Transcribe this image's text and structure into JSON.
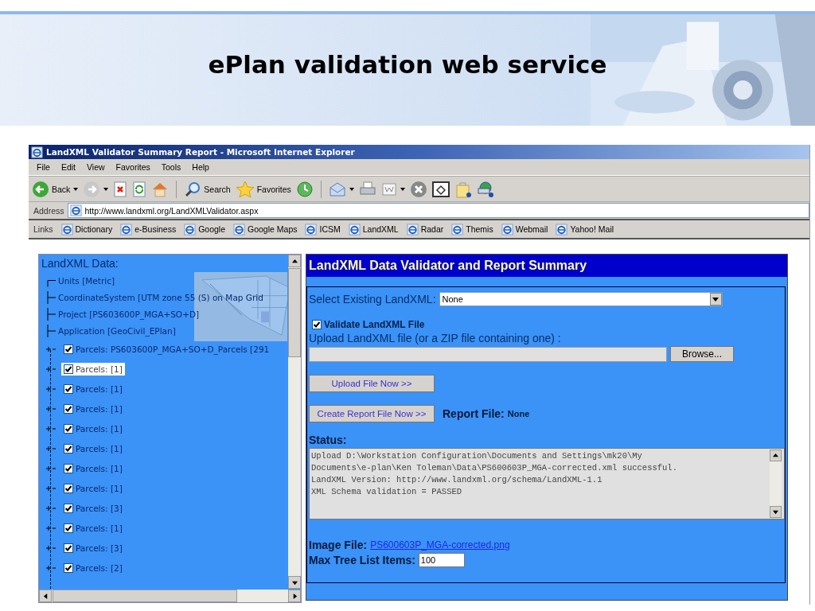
{
  "slide": {
    "title": "ePlan validation web service"
  },
  "window": {
    "title": "LandXML Validator Summary Report - Microsoft Internet Explorer"
  },
  "menu": [
    "File",
    "Edit",
    "View",
    "Favorites",
    "Tools",
    "Help"
  ],
  "toolbar": [
    {
      "kind": "back",
      "label": "Back"
    },
    {
      "kind": "forward"
    },
    {
      "kind": "stop"
    },
    {
      "kind": "refresh"
    },
    {
      "kind": "home"
    },
    {
      "kind": "search",
      "label": "Search"
    },
    {
      "kind": "favorites",
      "label": "Favorites"
    },
    {
      "kind": "history"
    },
    {
      "kind": "mail"
    },
    {
      "kind": "print"
    },
    {
      "kind": "edit"
    },
    {
      "kind": "close"
    },
    {
      "kind": "window"
    },
    {
      "kind": "bag"
    },
    {
      "kind": "messenger"
    }
  ],
  "address": {
    "label": "Address",
    "value": "http://www.landxml.org/LandXMLValidator.aspx"
  },
  "links": {
    "label": "Links",
    "items": [
      "Dictionary",
      "e-Business",
      "Google",
      "Google Maps",
      "ICSM",
      "LandXML",
      "Radar",
      "Themis",
      "Webmail",
      "Yahoo! Mail"
    ]
  },
  "tree": {
    "title": "LandXML Data:",
    "items": [
      {
        "kind": "leaf",
        "label": "Units [Metric]"
      },
      {
        "kind": "leaf",
        "label": "CoordinateSystem [UTM zone 55 (S) on Map Grid"
      },
      {
        "kind": "leaf",
        "label": "Project [PS603600P_MGA+SO+D]"
      },
      {
        "kind": "leaf",
        "label": "Application [GeoCivil_EPlan]"
      },
      {
        "kind": "parcel",
        "label": "Parcels: PS603600P_MGA+SO+D_Parcels [291",
        "checked": true,
        "expanded": false,
        "selected": false
      },
      {
        "kind": "parcel",
        "label": "Parcels: [1]",
        "checked": true,
        "expanded": false,
        "selected": true
      },
      {
        "kind": "parcel",
        "label": "Parcels: [1]",
        "checked": true,
        "expanded": false,
        "selected": false
      },
      {
        "kind": "parcel",
        "label": "Parcels: [1]",
        "checked": true,
        "expanded": false,
        "selected": false
      },
      {
        "kind": "parcel",
        "label": "Parcels: [1]",
        "checked": true,
        "expanded": false,
        "selected": false
      },
      {
        "kind": "parcel",
        "label": "Parcels: [1]",
        "checked": true,
        "expanded": false,
        "selected": false
      },
      {
        "kind": "parcel",
        "label": "Parcels: [1]",
        "checked": true,
        "expanded": false,
        "selected": false
      },
      {
        "kind": "parcel",
        "label": "Parcels: [1]",
        "checked": true,
        "expanded": false,
        "selected": false
      },
      {
        "kind": "parcel",
        "label": "Parcels: [3]",
        "checked": true,
        "expanded": false,
        "selected": false
      },
      {
        "kind": "parcel",
        "label": "Parcels: [1]",
        "checked": true,
        "expanded": false,
        "selected": false
      },
      {
        "kind": "parcel",
        "label": "Parcels: [3]",
        "checked": true,
        "expanded": false,
        "selected": false
      },
      {
        "kind": "parcel",
        "label": "Parcels: [2]",
        "checked": true,
        "expanded": false,
        "selected": false
      }
    ]
  },
  "main": {
    "heading": "LandXML Data Validator and Report Summary",
    "select": {
      "label": "Select Existing LandXML:",
      "value": "None"
    },
    "validate": {
      "label": "Validate LandXML File",
      "checked": true
    },
    "upload_label": "Upload LandXML file (or a ZIP file containing one) :",
    "browse_button": "Browse...",
    "upload_button": "Upload File Now >>",
    "report_button": "Create Report File Now >>",
    "report_file": {
      "label": "Report File:",
      "value": "None"
    },
    "status": {
      "label": "Status:",
      "lines": [
        "Upload D:\\Workstation Configuration\\Documents and Settings\\mk20\\My",
        "Documents\\e-plan\\Ken Toleman\\Data\\PS600603P_MGA-corrected.xml successful.",
        "LandXML Version: http://www.landxml.org/schema/LandXML-1.1",
        "XML Schema validation = PASSED"
      ]
    },
    "image_file": {
      "label": "Image File:",
      "link": "PS600603P_MGA-corrected.png"
    },
    "max_items": {
      "label": "Max Tree List Items:",
      "value": "100"
    }
  }
}
